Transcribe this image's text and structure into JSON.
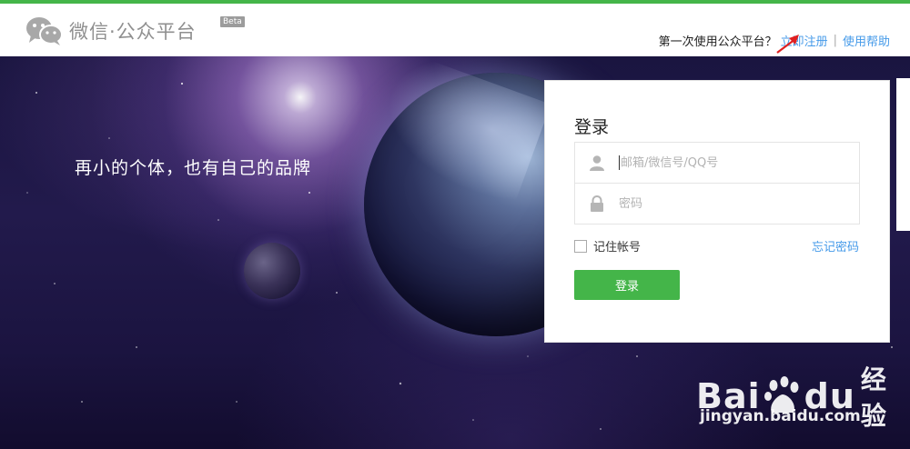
{
  "header": {
    "logo_text": "微信·公众平台",
    "beta": "Beta",
    "first_time_text": "第一次使用公众平台？",
    "register_link": "立即注册",
    "separator": "|",
    "help_link": "使用帮助"
  },
  "banner": {
    "slogan": "再小的个体，也有自己的品牌"
  },
  "login": {
    "title": "登录",
    "account_placeholder": "邮箱/微信号/QQ号",
    "account_value": "",
    "password_placeholder": "密码",
    "password_value": "",
    "remember_label": "记住帐号",
    "remember_checked": false,
    "forgot_link": "忘记密码",
    "submit_label": "登录"
  },
  "watermark": {
    "brand_left": "Bai",
    "brand_right": "du",
    "brand_suffix": "经验",
    "url": "jingyan.baidu.com"
  },
  "colors": {
    "accent_green": "#44b549",
    "link_blue": "#459ae9",
    "annotation_red": "#e02020"
  },
  "icons": {
    "logo": "wechat-logo-icon",
    "account": "user-icon",
    "password": "lock-icon",
    "annotation": "red-arrow-icon",
    "watermark": "baidu-paw-icon"
  }
}
